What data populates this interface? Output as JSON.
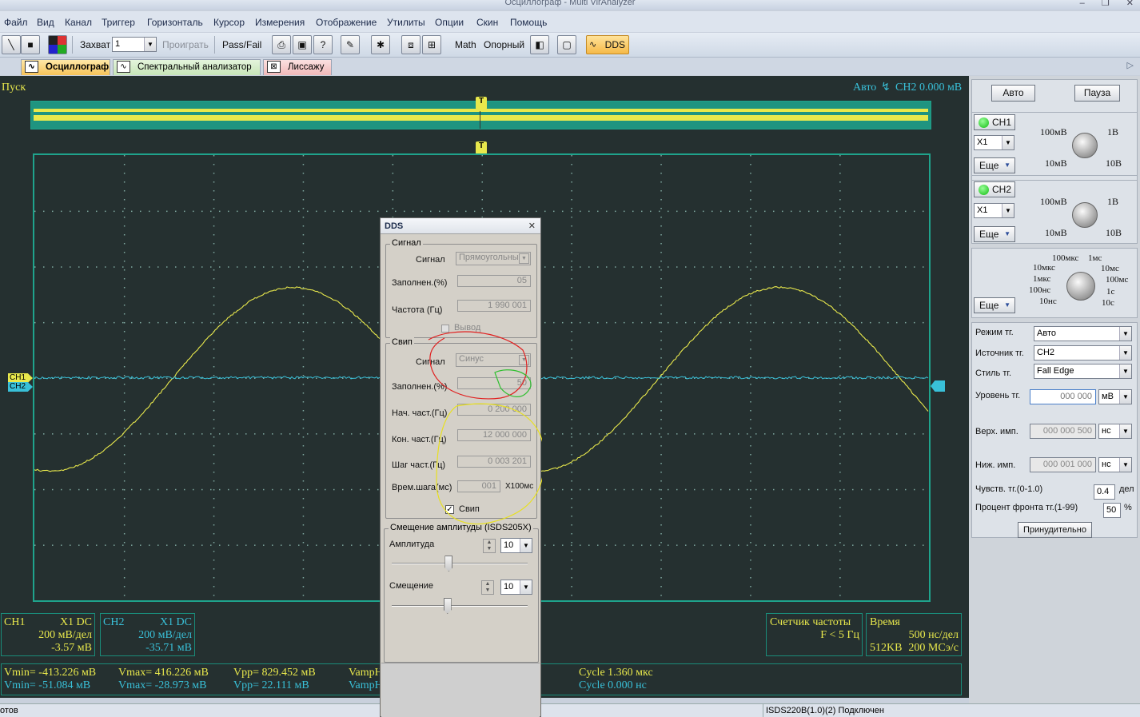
{
  "window": {
    "title": "Осциллограф - Multi VirAnalyzer",
    "buttons": [
      "–",
      "❐",
      "✕"
    ]
  },
  "menu": [
    "Файл",
    "Вид",
    "Канал",
    "Триггер",
    "Горизонталь",
    "Курсор",
    "Измерения",
    "Отображение",
    "Утилиты",
    "Опции",
    "Скин",
    "Помощь"
  ],
  "toolbar": {
    "capture_label": "Захват",
    "capture_value": "1",
    "play": "Проиграть",
    "passfail": "Pass/Fail",
    "math": "Math",
    "reference": "Опорный",
    "dds": "DDS"
  },
  "tabs": [
    "Осциллограф",
    "Спектральный анализатор",
    "Лиссажу"
  ],
  "plot": {
    "status": "Пуск",
    "trigger_info": "Авто",
    "trigger_channel": "CH2 0.000 мВ",
    "trigger_marker": "T",
    "ch1_marker": "CH1",
    "ch2_marker": "CH2"
  },
  "ch1_box": {
    "name": "CH1",
    "probe": "X1  DC",
    "scale": "200 мВ/дел",
    "offset": "-3.57 мВ"
  },
  "ch2_box": {
    "name": "CH2",
    "probe": "X1  DC",
    "scale": "200 мВ/дел",
    "offset": "-35.71 мВ"
  },
  "freq_box": {
    "title": "Счетчик частоты",
    "value": "F < 5 Гц"
  },
  "time_box": {
    "title": "Время",
    "scale": "500 нс/дел",
    "memory": "512KB",
    "rate": "200 МСэ/с"
  },
  "measurements": {
    "row1": [
      "Vmin= -413.226 мВ",
      "Vmax= 416.226 мВ",
      "Vpp= 829.452 мВ",
      "VampH",
      "Cycle 1.360 мкс"
    ],
    "row2": [
      "Vmin= -51.084 мВ",
      "Vmax= -28.973 мВ",
      "Vpp= 22.111 мВ",
      "VampH",
      "Cycle 0.000 нс"
    ]
  },
  "status_bar": {
    "left": "отов",
    "right": "ISDS220B(1.0)(2) Подключен"
  },
  "right_panel": {
    "auto": "Авто",
    "pause": "Пауза",
    "ch1": {
      "name": "CH1",
      "probe": "X1",
      "more": "Еще",
      "labels": [
        "100мВ",
        "1В",
        "10мВ",
        "10В"
      ]
    },
    "ch2": {
      "name": "CH2",
      "probe": "X1",
      "more": "Еще",
      "labels": [
        "100мВ",
        "1В",
        "10мВ",
        "10В"
      ]
    },
    "time": {
      "more": "Еще",
      "labels": [
        "100мкс",
        "1мс",
        "10мкс",
        "10мс",
        "1мкс",
        "100мс",
        "100нс",
        "1с",
        "10нс",
        "10с"
      ]
    },
    "trig_mode_label": "Режим тг.",
    "trig_mode": "Авто",
    "trig_source_label": "Источник тг.",
    "trig_source": "CH2",
    "trig_style_label": "Стиль тг.",
    "trig_style": "Fall Edge",
    "trig_level_label": "Уровень тг.",
    "trig_level": "000 000",
    "trig_level_unit": "мВ",
    "upper_label": "Верх. имп.",
    "upper": "000 000 500",
    "upper_unit": "нс",
    "lower_label": "Ниж. имп.",
    "lower": "000 001 000",
    "lower_unit": "нс",
    "sens_label": "Чувств. тг.(0-1.0)",
    "sens": "0.4",
    "sens_unit": "дел",
    "front_label": "Процент фронта тг.(1-99)",
    "front": "50",
    "front_unit": "%",
    "force": "Принудительно"
  },
  "dds": {
    "title": "DDS",
    "close": "✕",
    "signal_group": "Сигнал",
    "signal_label": "Сигнал",
    "signal_value": "Прямоугольны",
    "fill_label": "Заполнен.(%)",
    "fill_value": "05",
    "freq_label": "Частота (Гц)",
    "freq_value": "1 990 001",
    "output_label": "Вывод",
    "sweep_group": "Свип",
    "sweep_signal_label": "Сигнал",
    "sweep_signal_value": "Синус",
    "sweep_fill_label": "Заполнен.(%)",
    "sweep_fill_value": "50",
    "start_label": "Нач. част.(Гц)",
    "start_value": "0 200 000",
    "end_label": "Кон. част.(Гц)",
    "end_value": "12 000 000",
    "step_label": "Шаг част.(Гц)",
    "step_value": "0 003 201",
    "steptime_label": "Врем.шага(мс)",
    "steptime_value": "001",
    "steptime_unit": "X100мс",
    "sweep_check": "Свип",
    "ampl_group": "Смещение амплитуды (ISDS205X)",
    "amp_label": "Амплитуда",
    "amp_value": "10",
    "offset_label": "Смещение",
    "offset_value": "10",
    "amp_slider": 0.42,
    "offset_slider": 0.41
  },
  "colors": {
    "ch1": "#e8e84c",
    "ch2": "#39c0d8",
    "grid": "#1fa38c",
    "bg": "#253030"
  }
}
